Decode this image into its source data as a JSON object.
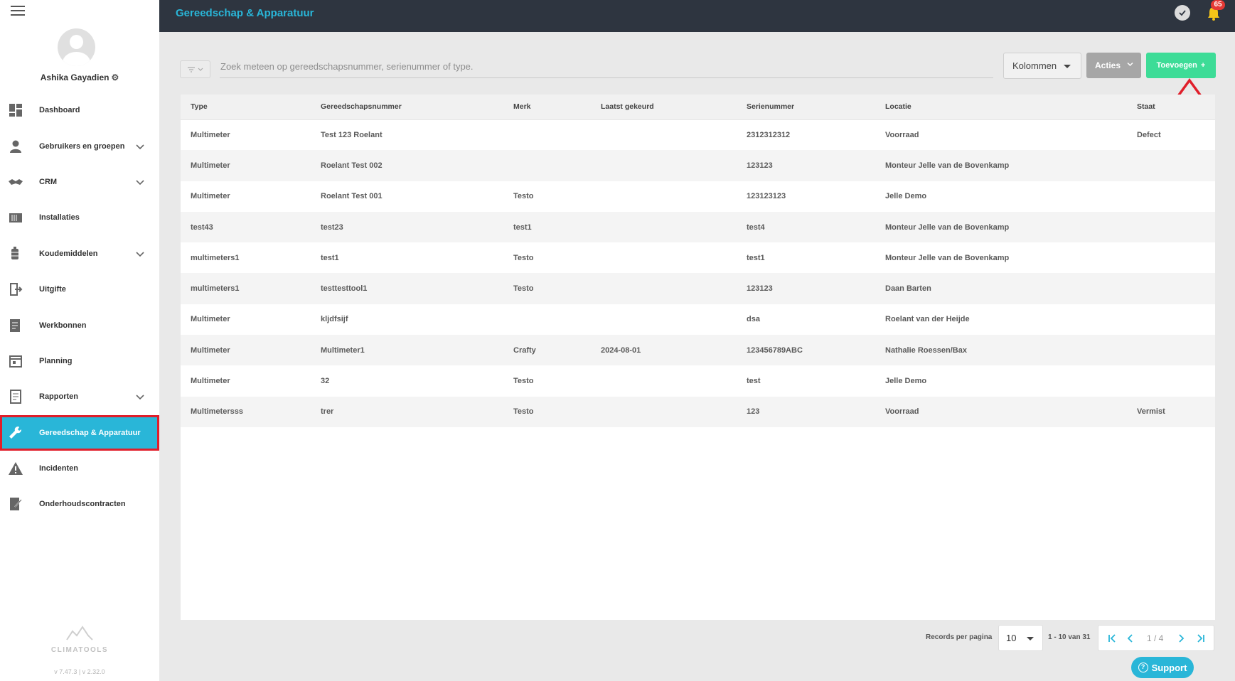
{
  "header": {
    "title": "Gereedschap & Apparatuur",
    "notification_count": "65"
  },
  "user": {
    "name": "Ashika Gayadien"
  },
  "sidebar": {
    "items": [
      {
        "label": "Dashboard",
        "icon": "dashboard-icon",
        "expandable": false
      },
      {
        "label": "Gebruikers en groepen",
        "icon": "user-icon",
        "expandable": true
      },
      {
        "label": "CRM",
        "icon": "handshake-icon",
        "expandable": true
      },
      {
        "label": "Installaties",
        "icon": "installation-icon",
        "expandable": false
      },
      {
        "label": "Koudemiddelen",
        "icon": "refrigerant-icon",
        "expandable": true
      },
      {
        "label": "Uitgifte",
        "icon": "issue-icon",
        "expandable": false
      },
      {
        "label": "Werkbonnen",
        "icon": "workorder-icon",
        "expandable": false
      },
      {
        "label": "Planning",
        "icon": "calendar-icon",
        "expandable": false
      },
      {
        "label": "Rapporten",
        "icon": "report-icon",
        "expandable": true
      },
      {
        "label": "Gereedschap & Apparatuur",
        "icon": "wrench-icon",
        "expandable": false,
        "active": true
      },
      {
        "label": "Incidenten",
        "icon": "warning-icon",
        "expandable": false
      },
      {
        "label": "Onderhoudscontracten",
        "icon": "contract-icon",
        "expandable": false
      }
    ]
  },
  "brand": {
    "name": "CLIMATOOLS",
    "version": "v 7.47.3   | v 2.32.0"
  },
  "toolbar": {
    "search_placeholder": "Zoek meteen op gereedschapsnummer, serienummer of type.",
    "columns_label": "Kolommen",
    "actions_label": "Acties",
    "add_label": "Toevoegen"
  },
  "table": {
    "columns": [
      "Type",
      "Gereedschapsnummer",
      "Merk",
      "Laatst gekeurd",
      "Serienummer",
      "Locatie",
      "Staat"
    ],
    "rows": [
      [
        "Multimeter",
        "Test 123 Roelant",
        "",
        "",
        "2312312312",
        "Voorraad",
        "Defect"
      ],
      [
        "Multimeter",
        "Roelant Test 002",
        "",
        "",
        "123123",
        "Monteur Jelle van de Bovenkamp",
        ""
      ],
      [
        "Multimeter",
        "Roelant Test 001",
        "Testo",
        "",
        "123123123",
        "Jelle Demo",
        ""
      ],
      [
        "test43",
        "test23",
        "test1",
        "",
        "test4",
        "Monteur Jelle van de Bovenkamp",
        ""
      ],
      [
        "multimeters1",
        "test1",
        "Testo",
        "",
        "test1",
        "Monteur Jelle van de Bovenkamp",
        ""
      ],
      [
        "multimeters1",
        "testtesttool1",
        "Testo",
        "",
        "123123",
        "Daan Barten",
        ""
      ],
      [
        "Multimeter",
        "kljdfsijf",
        "",
        "",
        "dsa",
        "Roelant van der Heijde",
        ""
      ],
      [
        "Multimeter",
        "Multimeter1",
        "Crafty",
        "2024-08-01",
        "123456789ABC",
        "Nathalie Roessen/Bax",
        ""
      ],
      [
        "Multimeter",
        "32",
        "Testo",
        "",
        "test",
        "Jelle Demo",
        ""
      ],
      [
        "Multimetersss",
        "trer",
        "Testo",
        "",
        "123",
        "Voorraad",
        "Vermist"
      ]
    ]
  },
  "pagination": {
    "records_per_page_label": "Records per pagina",
    "records_per_page": "10",
    "range": "1 - 10 van 31",
    "page_indicator": "1 / 4"
  },
  "support": {
    "label": "Support"
  },
  "colors": {
    "accent": "#29b6d8",
    "header_bg": "#2e3540",
    "add_button": "#3ddc97",
    "highlight": "#e01e2a"
  }
}
